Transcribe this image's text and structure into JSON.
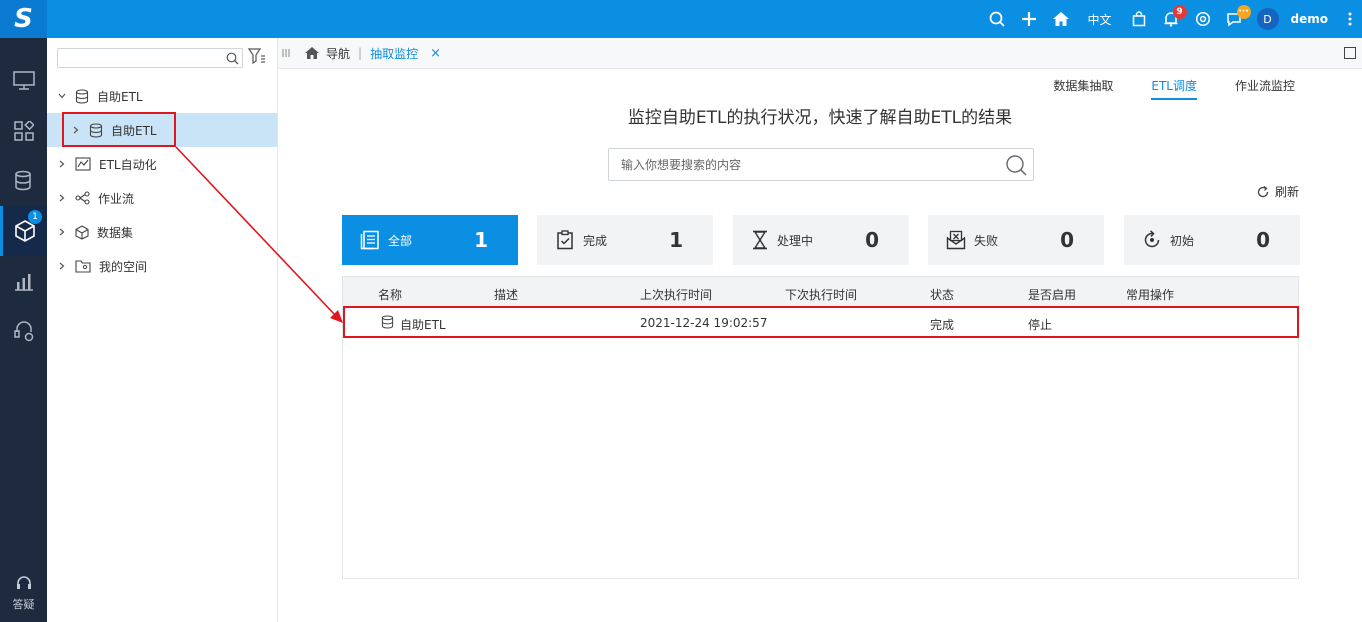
{
  "app": {
    "logo": "S"
  },
  "topbar": {
    "language": "中文",
    "notifications_count": "9",
    "chat_badge": "···",
    "avatar_letter": "D",
    "username": "demo"
  },
  "leftnav": {
    "items_badge": "1",
    "help_label": "答疑"
  },
  "tree": {
    "search_placeholder": "",
    "items": [
      {
        "label": "自助ETL"
      },
      {
        "label": "自助ETL"
      },
      {
        "label": "ETL自动化"
      },
      {
        "label": "作业流"
      },
      {
        "label": "数据集"
      },
      {
        "label": "我的空间"
      }
    ]
  },
  "tabs": {
    "nav_label": "导航",
    "active_label": "抽取监控",
    "close": "×"
  },
  "subtabs": [
    "数据集抽取",
    "ETL调度",
    "作业流监控"
  ],
  "headline": "监控自助ETL的执行状况，快速了解自助ETL的结果",
  "search": {
    "placeholder": "输入你想要搜索的内容"
  },
  "refresh_label": "刷新",
  "cards": [
    {
      "label": "全部",
      "count": "1"
    },
    {
      "label": "完成",
      "count": "1"
    },
    {
      "label": "处理中",
      "count": "0"
    },
    {
      "label": "失败",
      "count": "0"
    },
    {
      "label": "初始",
      "count": "0"
    }
  ],
  "table": {
    "headers": [
      "名称",
      "描述",
      "上次执行时间",
      "下次执行时间",
      "状态",
      "是否启用",
      "常用操作"
    ],
    "rows": [
      {
        "name": "自助ETL",
        "desc": "",
        "last": "2021-12-24 19:02:57",
        "next": "",
        "status": "完成",
        "enabled": "停止",
        "ops": ""
      }
    ]
  },
  "colors": {
    "accent": "#0a8fe3",
    "sidebar": "#1e2a3e",
    "annotation": "#e0161c"
  }
}
